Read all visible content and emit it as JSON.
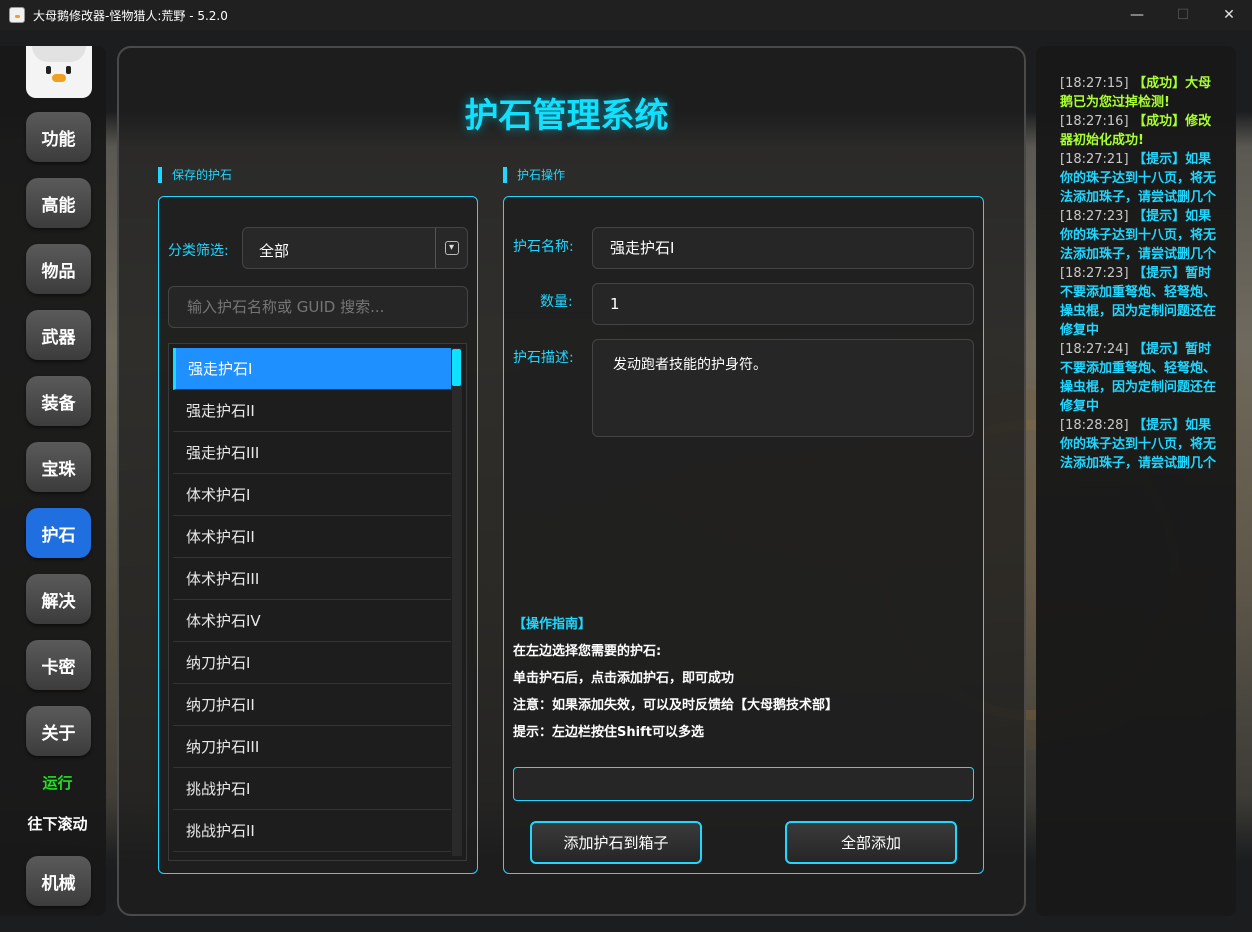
{
  "window": {
    "title": "大母鹅修改器-怪物猎人:荒野 - 5.2.0",
    "controls": [
      "—",
      "☐",
      "✕"
    ]
  },
  "nav": {
    "items": [
      "功能",
      "高能",
      "物品",
      "武器",
      "装备",
      "宝珠",
      "护石",
      "解决",
      "卡密",
      "关于"
    ],
    "active": "护石",
    "run_label": "运行",
    "scroll_label": "往下滚动",
    "bottom_item": "机械"
  },
  "page": {
    "title": "护石管理系统",
    "left_section": "保存的护石",
    "right_section": "护石操作"
  },
  "filter": {
    "label": "分类筛选:",
    "selected": "全部"
  },
  "search": {
    "placeholder": "输入护石名称或 GUID 搜索..."
  },
  "charm_list": [
    "强走护石I",
    "强走护石II",
    "强走护石III",
    "体术护石I",
    "体术护石II",
    "体术护石III",
    "体术护石IV",
    "纳刀护石I",
    "纳刀护石II",
    "纳刀护石III",
    "挑战护石I",
    "挑战护石II"
  ],
  "charm_form": {
    "name_label": "护石名称:",
    "name_value": "强走护石I",
    "qty_label": "数量:",
    "qty_value": "1",
    "desc_label": "护石描述:",
    "desc_value": "发动跑者技能的护身符。"
  },
  "guide": {
    "heading": "【操作指南】",
    "lines": [
      "在左边选择您需要的护石:",
      "单击护石后，点击添加护石，即可成功",
      "注意：如果添加失效，可以及时反馈给【大母鹅技术部】",
      "提示：左边栏按住Shift可以多选"
    ]
  },
  "buttons": {
    "add": "添加护石到箱子",
    "add_all": "全部添加"
  },
  "log": [
    {
      "time": "[18:27:15]",
      "type": "success",
      "text": "【成功】大母鹅已为您过掉检测!"
    },
    {
      "time": "[18:27:16]",
      "type": "success",
      "text": "【成功】修改器初始化成功!"
    },
    {
      "time": "[18:27:21]",
      "type": "tip",
      "text": "【提示】如果你的珠子达到十八页，将无法添加珠子，请尝试删几个"
    },
    {
      "time": "[18:27:23]",
      "type": "tip",
      "text": "【提示】如果你的珠子达到十八页，将无法添加珠子，请尝试删几个"
    },
    {
      "time": "[18:27:23]",
      "type": "tip",
      "text": "【提示】暂时不要添加重弩炮、轻弩炮、操虫棍，因为定制问题还在修复中"
    },
    {
      "time": "[18:27:24]",
      "type": "tip",
      "text": "【提示】暂时不要添加重弩炮、轻弩炮、操虫棍，因为定制问题还在修复中"
    },
    {
      "time": "[18:28:28]",
      "type": "tip",
      "text": "【提示】如果你的珠子达到十八页，将无法添加珠子，请尝试删几个"
    }
  ],
  "colors": {
    "accent": "#21d6ff",
    "title": "#12e0ff",
    "active_nav": "#1f6fe0",
    "selected_row": "#1e90ff",
    "success": "#a8ff30",
    "run": "#22e022"
  }
}
